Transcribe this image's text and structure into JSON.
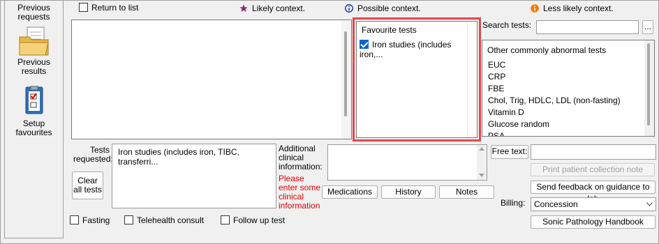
{
  "sidebar": {
    "previous_requests": "Previous requests",
    "previous_results": "Previous results",
    "setup_favourites": "Setup favourites"
  },
  "top": {
    "return_to_list": "Return to list",
    "likely_context": "Likely context.",
    "possible_context": "Possible context.",
    "less_likely_context": "Less likely context."
  },
  "favourites": {
    "header": "Favourite tests",
    "items": [
      {
        "label": "Iron studies (includes iron,...",
        "checked": true
      }
    ]
  },
  "search": {
    "label": "Search tests:",
    "value": "",
    "browse_label": "..."
  },
  "other_tests": {
    "header": "Other commonly abnormal tests",
    "items": [
      "EUC",
      "CRP",
      "FBE",
      "Chol, Trig, HDLC, LDL (non-fasting)",
      "Vitamin D",
      "Glucose random",
      "PSA"
    ]
  },
  "requested": {
    "label": "Tests requested:",
    "value": "Iron studies (includes iron, TIBC, transferri...",
    "clear_all": "Clear all tests"
  },
  "clinical": {
    "label": "Additional clinical information:",
    "warning": "Please enter some clinical information",
    "value": ""
  },
  "buttons": {
    "medications": "Medications",
    "history": "History",
    "notes": "Notes",
    "free_text": "Free text:",
    "print_collection": "Print patient collection note",
    "send_feedback": "Send feedback on guidance to lab",
    "handbook": "Sonic Pathology Handbook"
  },
  "billing": {
    "label": "Billing:",
    "selected": "Concession"
  },
  "bottom": {
    "fasting": "Fasting",
    "telehealth": "Telehealth consult",
    "follow_up": "Follow up test"
  },
  "colors": {
    "highlight_border": "#e0484c",
    "likely_star": "#8b2c7d",
    "possible_icon": "#1a3fb0",
    "less_likely_icon": "#f07d00",
    "warning_text": "#e00000"
  }
}
